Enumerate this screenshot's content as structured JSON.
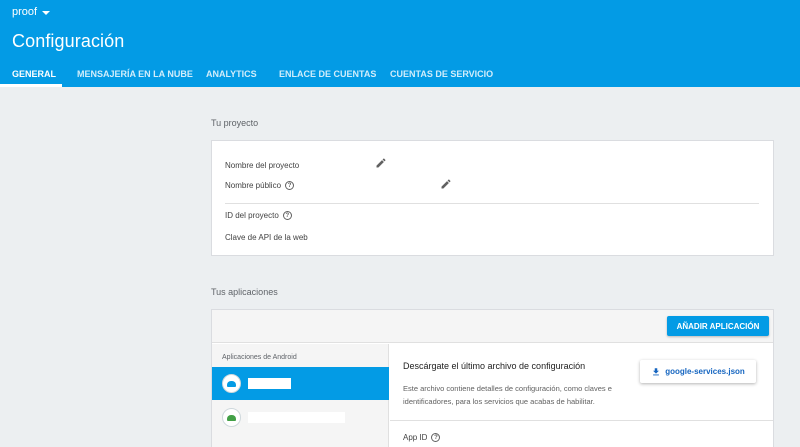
{
  "header": {
    "project_name": "proof",
    "title": "Configuración",
    "bg_color": "#039be5"
  },
  "tabs": [
    {
      "label": "GENERAL",
      "active": true
    },
    {
      "label": "MENSAJERÍA EN LA NUBE",
      "active": false
    },
    {
      "label": "ANALYTICS",
      "active": false
    },
    {
      "label": "ENLACE DE CUENTAS",
      "active": false
    },
    {
      "label": "CUENTAS DE SERVICIO",
      "active": false
    }
  ],
  "project_section": {
    "heading": "Tu proyecto",
    "fields": {
      "project_name_label": "Nombre del proyecto",
      "public_name_label": "Nombre público",
      "project_id_label": "ID del proyecto",
      "web_api_key_label": "Clave de API de la web"
    }
  },
  "apps_section": {
    "heading": "Tus aplicaciones",
    "add_app_label": "AÑADIR APLICACIÓN",
    "sidebar_heading": "Aplicaciones de Android",
    "detail": {
      "title": "Descárgate el último archivo de configuración",
      "description": "Este archivo contiene detalles de configuración, como claves e identificadores, para los servicios que acabas de habilitar.",
      "download_label": "google-services.json",
      "app_id_label": "App ID"
    },
    "android_color": "#039be5",
    "android_color_alt": "#43a047"
  }
}
